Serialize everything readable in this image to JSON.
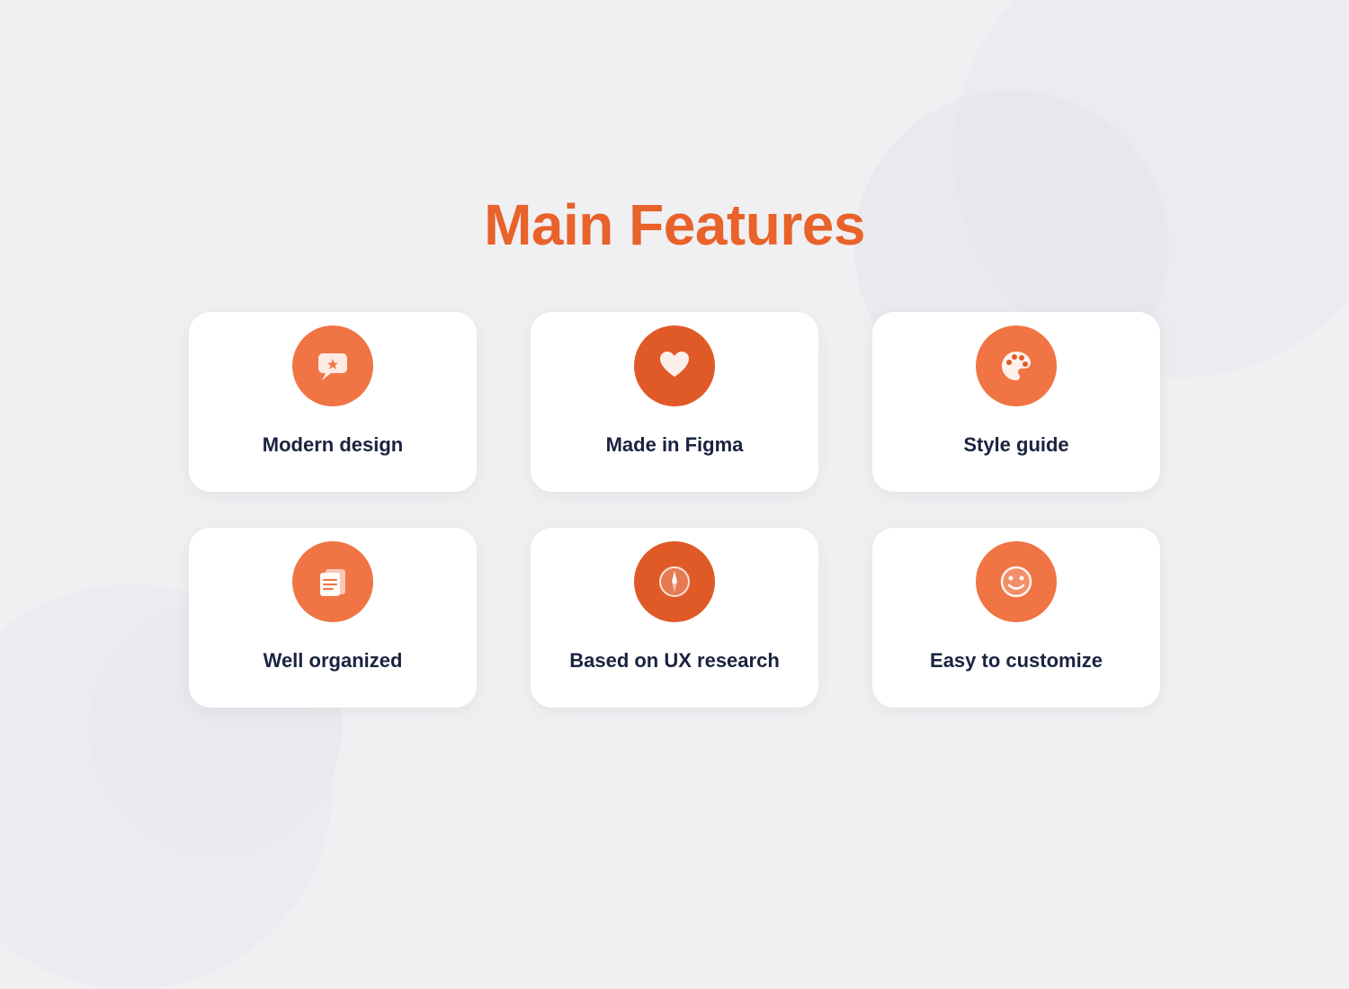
{
  "page": {
    "title": "Main Features",
    "title_color": "#e8622a",
    "background_color": "#f0f0f3"
  },
  "features": [
    {
      "id": "modern-design",
      "label": "Modern design",
      "icon": "sparkle-chat",
      "icon_style": "light"
    },
    {
      "id": "made-in-figma",
      "label": "Made in Figma",
      "icon": "heart",
      "icon_style": "dark"
    },
    {
      "id": "style-guide",
      "label": "Style guide",
      "icon": "palette",
      "icon_style": "light"
    },
    {
      "id": "well-organized",
      "label": "Well organized",
      "icon": "files",
      "icon_style": "light"
    },
    {
      "id": "ux-research",
      "label": "Based on UX research",
      "icon": "compass",
      "icon_style": "dark"
    },
    {
      "id": "easy-customize",
      "label": "Easy to customize",
      "icon": "smiley",
      "icon_style": "light"
    }
  ]
}
